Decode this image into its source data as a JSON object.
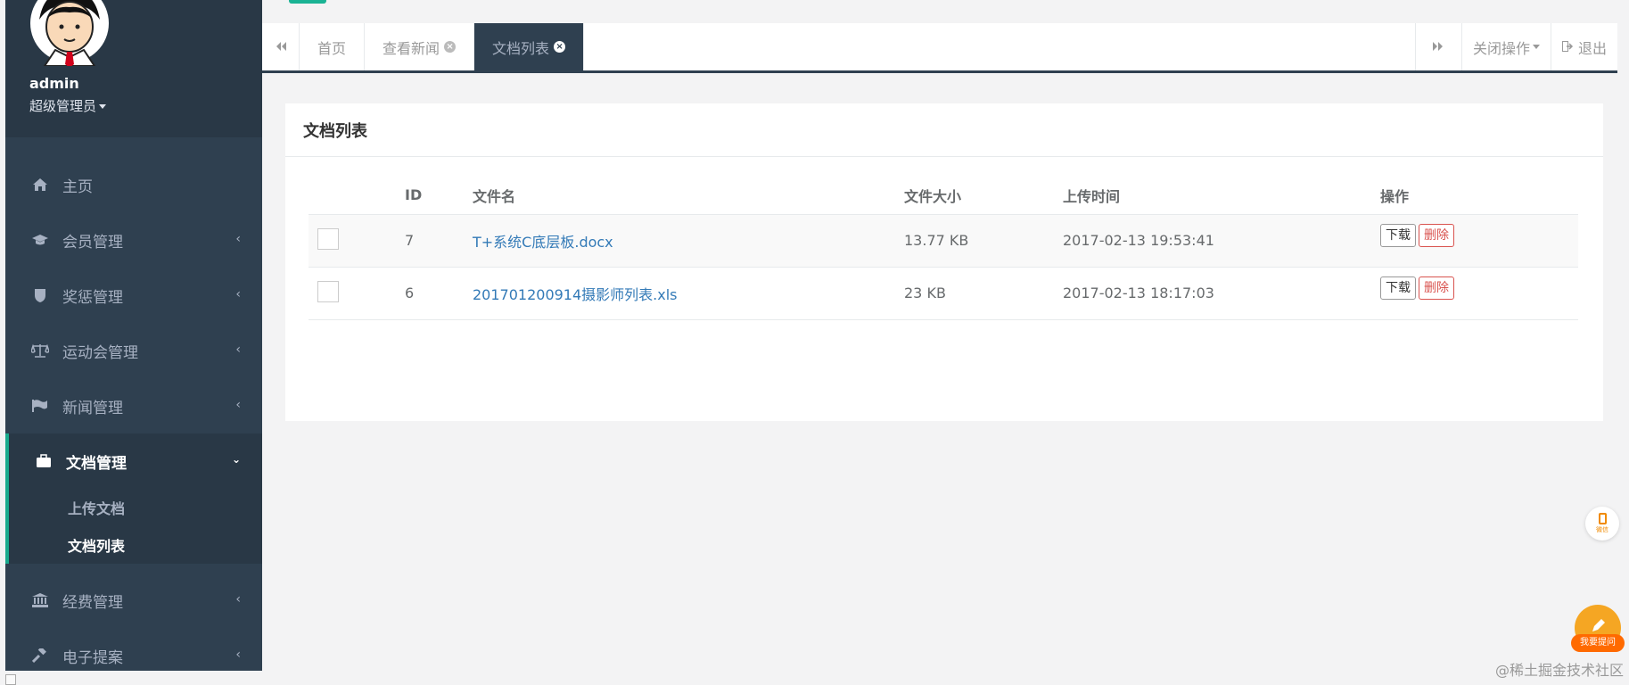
{
  "sidebar": {
    "profile": {
      "name": "admin",
      "role": "超级管理员"
    },
    "items": [
      {
        "label": "主页",
        "icon": "home-icon",
        "arrow": ""
      },
      {
        "label": "会员管理",
        "icon": "graduation-cap-icon",
        "arrow": "‹"
      },
      {
        "label": "奖惩管理",
        "icon": "shield-icon",
        "arrow": "‹"
      },
      {
        "label": "运动会管理",
        "icon": "balance-scale-icon",
        "arrow": "‹"
      },
      {
        "label": "新闻管理",
        "icon": "flag-icon",
        "arrow": "‹"
      },
      {
        "label": "经费管理",
        "icon": "bank-icon",
        "arrow": "‹"
      },
      {
        "label": "电子提案",
        "icon": "gavel-icon",
        "arrow": "‹"
      }
    ],
    "active_group": {
      "label": "文档管理",
      "icon": "briefcase-icon",
      "arrow": "⌄",
      "children": [
        {
          "label": "上传文档"
        },
        {
          "label": "文档列表"
        }
      ]
    }
  },
  "tabs": {
    "back_icon": "double-left-icon",
    "items": [
      {
        "label": "首页"
      },
      {
        "label": "查看新闻"
      },
      {
        "label": "文档列表"
      }
    ],
    "forward_icon": "double-right-icon",
    "close_ops_label": "关闭操作",
    "logout_label": "退出"
  },
  "panel": {
    "title": "文档列表",
    "columns": [
      "ID",
      "文件名",
      "文件大小",
      "上传时间",
      "操作"
    ],
    "rows": [
      {
        "id": "7",
        "filename": "T+系统C底层板.docx",
        "size": "13.77 KB",
        "time": "2017-02-13 19:53:41"
      },
      {
        "id": "6",
        "filename": "201701200914摄影师列表.xls",
        "size": "23 KB",
        "time": "2017-02-13 18:17:03"
      }
    ],
    "download_label": "下载",
    "delete_label": "删除"
  },
  "widgets": {
    "phone_label": "微信",
    "ask_label": "我要提问",
    "watermark": "@稀土掘金技术社区"
  },
  "colors": {
    "sidebar_bg": "#2f4050",
    "accent_green": "#1ab394",
    "link_blue": "#337ab7",
    "danger_red": "#d9534f"
  }
}
